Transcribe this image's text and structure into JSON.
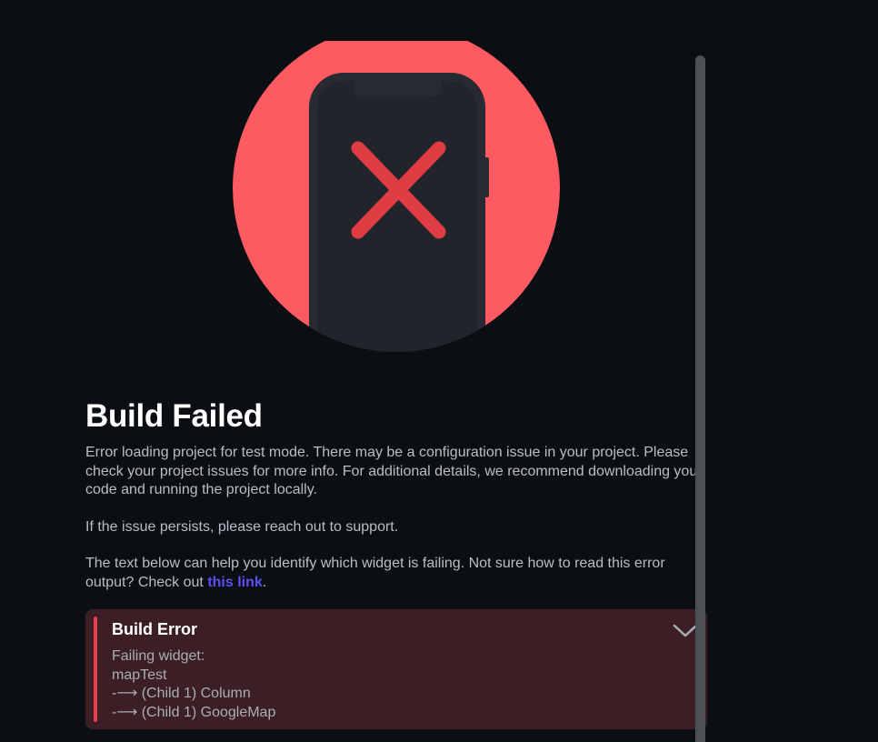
{
  "hero": {
    "circle_color": "#fd5a62",
    "phone_color": "#21252b",
    "x_mark_color": "#df3c44",
    "icon": "phone-error-icon"
  },
  "title": "Build Failed",
  "paragraphs": {
    "p1": "Error loading project for test mode. There may be a configuration issue in your project. Please check your project issues for more info. For additional details, we recommend downloading your code and running the project locally.",
    "p2": "If the issue persists, please reach out to support.",
    "p3_prefix": "The text below can help you identify which widget is failing. Not sure how to read this error output? Check out ",
    "p3_link": "this link",
    "p3_suffix": "."
  },
  "error_card": {
    "title": "Build Error",
    "chevron_icon": "chevron-down-icon",
    "lines": [
      "Failing widget:",
      "mapTest",
      "-⟶ (Child 1) Column",
      "-⟶ (Child 1) GoogleMap"
    ],
    "accent_color": "#e5404b"
  }
}
